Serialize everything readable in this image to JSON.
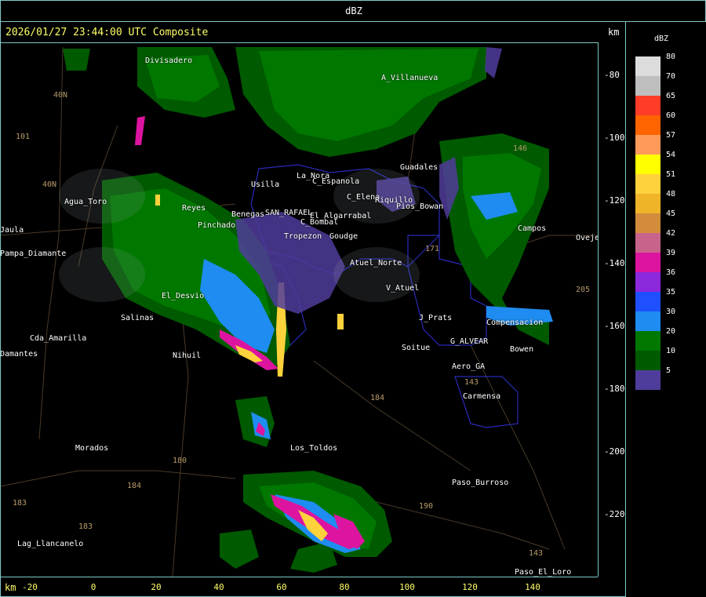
{
  "header": {
    "product": "dBZ",
    "timestamp": "2026/01/27 23:44:00 UTC Composite",
    "unit_top": "km",
    "unit_bottom": "km"
  },
  "axes": {
    "y_ticks": [
      "-80",
      "-100",
      "-120",
      "-140",
      "-160",
      "-180",
      "-200",
      "-220"
    ],
    "x_ticks": [
      "-20",
      "0",
      "20",
      "40",
      "60",
      "80",
      "100",
      "120",
      "140"
    ]
  },
  "legend": {
    "title": "dBZ",
    "levels": [
      {
        "label": "80",
        "color": "#dcdcdc"
      },
      {
        "label": "70",
        "color": "#bebebe"
      },
      {
        "label": "65",
        "color": "#ff3c28"
      },
      {
        "label": "60",
        "color": "#ff6400"
      },
      {
        "label": "57",
        "color": "#ff9a5a"
      },
      {
        "label": "54",
        "color": "#ffff00"
      },
      {
        "label": "51",
        "color": "#ffd23c"
      },
      {
        "label": "48",
        "color": "#f0b428"
      },
      {
        "label": "45",
        "color": "#d28c3c"
      },
      {
        "label": "42",
        "color": "#c8648c"
      },
      {
        "label": "39",
        "color": "#dc14a0"
      },
      {
        "label": "36",
        "color": "#8c28dc"
      },
      {
        "label": "35",
        "color": "#1e50ff"
      },
      {
        "label": "30",
        "color": "#1e8cf0"
      },
      {
        "label": "20",
        "color": "#007800"
      },
      {
        "label": "10",
        "color": "#005a00"
      },
      {
        "label": "5",
        "color": "#503c9b"
      }
    ]
  },
  "places": [
    {
      "name": "Divisadero"
    },
    {
      "name": "A_Villanueva"
    },
    {
      "name": "Guadales"
    },
    {
      "name": "Agua_Toro"
    },
    {
      "name": "Pampa_Diamante"
    },
    {
      "name": "Usilla"
    },
    {
      "name": "La_Nora"
    },
    {
      "name": "C_Espanola"
    },
    {
      "name": "C_Elena"
    },
    {
      "name": "Riquillo"
    },
    {
      "name": "Pios_Bowan"
    },
    {
      "name": "Reyes"
    },
    {
      "name": "Pinchado"
    },
    {
      "name": "Benegas"
    },
    {
      "name": "SAN_RAFAEL"
    },
    {
      "name": "El_Algarrabal"
    },
    {
      "name": "C_Bombal"
    },
    {
      "name": "Tropezon"
    },
    {
      "name": "Goudge"
    },
    {
      "name": "Atuel_Norte"
    },
    {
      "name": "V_Atuel"
    },
    {
      "name": "El_Desvio"
    },
    {
      "name": "Salinas"
    },
    {
      "name": "Cda_Amarilla"
    },
    {
      "name": "Nihuil"
    },
    {
      "name": "Soitue"
    },
    {
      "name": "G_ALVEAR"
    },
    {
      "name": "Aero_GA"
    },
    {
      "name": "Carmensa"
    },
    {
      "name": "Bowen"
    },
    {
      "name": "Morados"
    },
    {
      "name": "Los_Toldos"
    },
    {
      "name": "Paso_Burroso"
    },
    {
      "name": "Lag_Llancanelo"
    },
    {
      "name": "Paso_El_Loro"
    },
    {
      "name": "Ovejeria"
    },
    {
      "name": "Jaula"
    },
    {
      "name": "Damantes"
    },
    {
      "name": "J_Prats"
    },
    {
      "name": "Compensacion"
    },
    {
      "name": "Campos"
    }
  ],
  "routes": [
    "40N",
    "101",
    "40N",
    "146",
    "171",
    "143",
    "190",
    "184",
    "180",
    "184",
    "183",
    "205",
    "183",
    "143"
  ]
}
